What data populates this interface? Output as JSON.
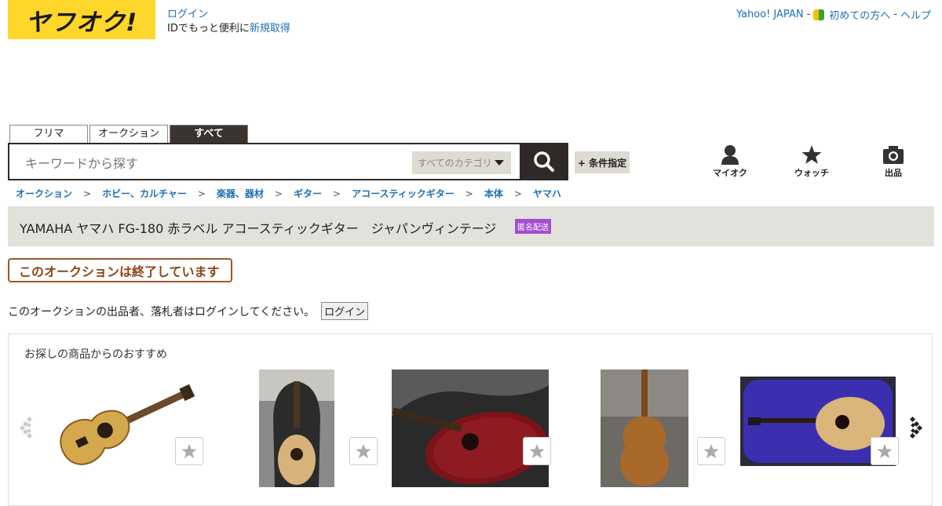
{
  "header": {
    "logo_text": "ヤフオク!",
    "login_label": "ログイン",
    "login_sub_prefix": "IDでもっと便利に",
    "signup_label": "新規取得",
    "links": {
      "yahoo": "Yahoo! JAPAN",
      "beginners": "初めての方へ",
      "help": "ヘルプ",
      "sep": "-"
    }
  },
  "search": {
    "tabs": [
      "フリマ",
      "オークション",
      "すべて"
    ],
    "active_tab": "すべて",
    "placeholder": "キーワードから探す",
    "category": "すべてのカテゴリ",
    "condition_label": "+ 条件指定"
  },
  "nav": {
    "myauc": "マイオク",
    "watch": "ウォッチ",
    "sell": "出品"
  },
  "breadcrumb": [
    "オークション",
    "ホビー、カルチャー",
    "楽器、器材",
    "ギター",
    "アコースティックギター",
    "本体",
    "ヤマハ"
  ],
  "breadcrumb_sep": ">",
  "item": {
    "title": "YAMAHA ヤマハ FG-180 赤ラベル アコースティックギター　ジャパンヴィンテージ",
    "badge": "匿名配送",
    "ended_label": "このオークションは終了しています",
    "notice": "このオークションの出品者、落札者はログインしてください。",
    "notice_button": "ログイン"
  },
  "recommend": {
    "heading": "お探しの商品からのおすすめ",
    "items": [
      {
        "desc": "acoustic guitar on white background"
      },
      {
        "desc": "acoustic guitar in gig bag"
      },
      {
        "desc": "red acoustic guitar in case"
      },
      {
        "desc": "back of acoustic guitar on sofa"
      },
      {
        "desc": "acoustic guitar in purple case"
      }
    ]
  },
  "colors": {
    "brand_yellow": "#ffd62a",
    "dark": "#2f2a28",
    "link": "#1e6fb4",
    "badge": "#a24ed1",
    "ended": "#8b4517"
  }
}
